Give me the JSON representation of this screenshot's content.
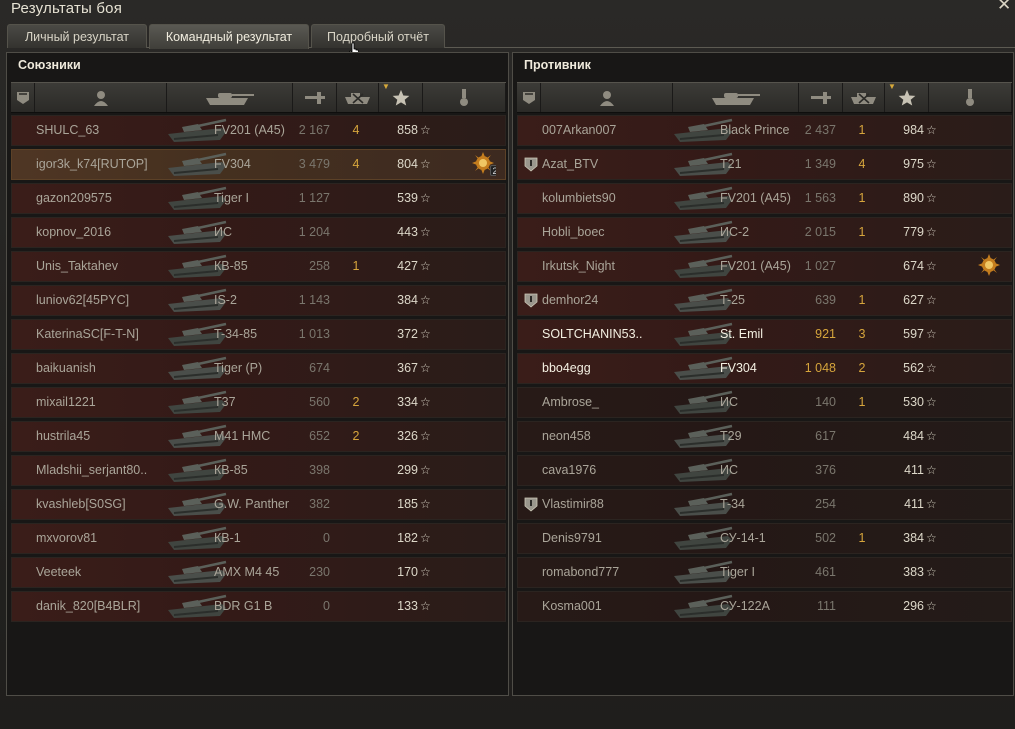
{
  "window": {
    "title": "Результаты боя"
  },
  "tabs": [
    {
      "label": "Личный результат"
    },
    {
      "label": "Командный результат"
    },
    {
      "label": "Подробный отчёт"
    }
  ],
  "allies": {
    "title": "Союзники",
    "rows": [
      {
        "name": "SHULC_63",
        "vehicle": "FV201 (A45)",
        "damage": "2 167",
        "kills": "4",
        "xp": "858",
        "style": "normal"
      },
      {
        "name": "igor3k_k74[RUTOP]",
        "vehicle": "FV304",
        "damage": "3 479",
        "kills": "4",
        "xp": "804",
        "style": "me",
        "medal": "2"
      },
      {
        "name": "gazon209575",
        "vehicle": "Tiger I",
        "damage": "1 127",
        "kills": "",
        "xp": "539",
        "style": "normal"
      },
      {
        "name": "kopnov_2016",
        "vehicle": "ИС",
        "damage": "1 204",
        "kills": "",
        "xp": "443",
        "style": "normal"
      },
      {
        "name": "Unis_Taktahev",
        "vehicle": "КВ-85",
        "damage": "258",
        "kills": "1",
        "xp": "427",
        "style": "normal"
      },
      {
        "name": "luniov62[45PYC]",
        "vehicle": "IS-2",
        "damage": "1 143",
        "kills": "",
        "xp": "384",
        "style": "normal"
      },
      {
        "name": "KaterinaSC[F-T-N]",
        "vehicle": "T-34-85",
        "damage": "1 013",
        "kills": "",
        "xp": "372",
        "style": "normal"
      },
      {
        "name": "baikuanish",
        "vehicle": "Tiger (P)",
        "damage": "674",
        "kills": "",
        "xp": "367",
        "style": "normal"
      },
      {
        "name": "mixail1221",
        "vehicle": "T37",
        "damage": "560",
        "kills": "2",
        "xp": "334",
        "style": "normal"
      },
      {
        "name": "hustrila45",
        "vehicle": "M41 HMC",
        "damage": "652",
        "kills": "2",
        "xp": "326",
        "style": "normal"
      },
      {
        "name": "Mladshii_serjant80..",
        "vehicle": "КВ-85",
        "damage": "398",
        "kills": "",
        "xp": "299",
        "style": "normal"
      },
      {
        "name": "kvashleb[S0SG]",
        "vehicle": "G.W. Panther",
        "damage": "382",
        "kills": "",
        "xp": "185",
        "style": "normal"
      },
      {
        "name": "mxvorov81",
        "vehicle": "КВ-1",
        "damage": "0",
        "kills": "",
        "xp": "182",
        "style": "normal"
      },
      {
        "name": "Veeteek",
        "vehicle": "AMX M4 45",
        "damage": "230",
        "kills": "",
        "xp": "170",
        "style": "normal"
      },
      {
        "name": "danik_820[B4BLR]",
        "vehicle": "BDR G1 B",
        "damage": "0",
        "kills": "",
        "xp": "133",
        "style": "normal"
      }
    ]
  },
  "enemies": {
    "title": "Противник",
    "rows": [
      {
        "name": "007Arkan007",
        "vehicle": "Black Prince",
        "damage": "2 437",
        "kills": "1",
        "xp": "984",
        "style": "normal"
      },
      {
        "name": "Azat_BTV",
        "vehicle": "T21",
        "damage": "1 349",
        "kills": "4",
        "xp": "975",
        "style": "normal",
        "badge": true
      },
      {
        "name": "kolumbiets90",
        "vehicle": "FV201 (A45)",
        "damage": "1 563",
        "kills": "1",
        "xp": "890",
        "style": "normal"
      },
      {
        "name": "Hobli_boec",
        "vehicle": "ИС-2",
        "damage": "2 015",
        "kills": "1",
        "xp": "779",
        "style": "normal"
      },
      {
        "name": "Irkutsk_Night",
        "vehicle": "FV201 (A45)",
        "damage": "1 027",
        "kills": "",
        "xp": "674",
        "style": "normal",
        "medal": ""
      },
      {
        "name": "demhor24",
        "vehicle": "T-25",
        "damage": "639",
        "kills": "1",
        "xp": "627",
        "style": "normal",
        "badge": true
      },
      {
        "name": "SOLTCHANIN53..",
        "vehicle": "St. Emil",
        "damage": "921",
        "kills": "3",
        "xp": "597",
        "style": "bright"
      },
      {
        "name": "bbo4egg",
        "vehicle": "FV304",
        "damage": "1 048",
        "kills": "2",
        "xp": "562",
        "style": "bright"
      },
      {
        "name": "Ambrose_",
        "vehicle": "ИС",
        "damage": "140",
        "kills": "1",
        "xp": "530",
        "style": "dim"
      },
      {
        "name": "neon458",
        "vehicle": "T29",
        "damage": "617",
        "kills": "",
        "xp": "484",
        "style": "dim"
      },
      {
        "name": "cava1976",
        "vehicle": "ИС",
        "damage": "376",
        "kills": "",
        "xp": "411",
        "style": "dim"
      },
      {
        "name": "Vlastimir88",
        "vehicle": "T-34",
        "damage": "254",
        "kills": "",
        "xp": "411",
        "style": "dim",
        "badge": true
      },
      {
        "name": "Denis9791",
        "vehicle": "СУ-14-1",
        "damage": "502",
        "kills": "1",
        "xp": "384",
        "style": "dim"
      },
      {
        "name": "romabond777",
        "vehicle": "Tiger I",
        "damage": "461",
        "kills": "",
        "xp": "383",
        "style": "dim"
      },
      {
        "name": "Kosma001",
        "vehicle": "СУ-122А",
        "damage": "111",
        "kills": "",
        "xp": "296",
        "style": "dim"
      }
    ]
  },
  "columns": [
    {
      "icon": "squad-badge-icon"
    },
    {
      "icon": "player-icon"
    },
    {
      "icon": "tank-icon"
    },
    {
      "icon": "damage-shell-icon"
    },
    {
      "icon": "destroyed-tank-icon"
    },
    {
      "icon": "experience-star-icon",
      "sorted": true
    },
    {
      "icon": "medal-icon"
    }
  ],
  "colors": {
    "accent": "#d6a53c",
    "row_red": "#3a1d19",
    "row_me": "#4f3624"
  }
}
